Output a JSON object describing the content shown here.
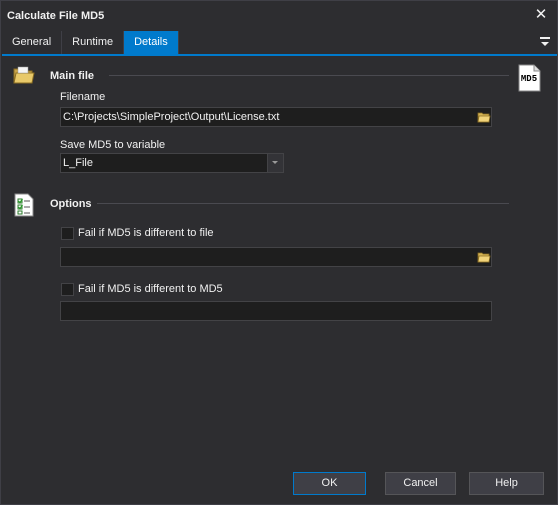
{
  "window": {
    "title": "Calculate File MD5",
    "close_glyph": "✕"
  },
  "tabs": [
    {
      "label": "General"
    },
    {
      "label": "Runtime"
    },
    {
      "label": "Details",
      "active": true
    }
  ],
  "tab_menu_icon": "tab-menu-icon",
  "main_file": {
    "section_title": "Main file",
    "icon": "folder-icon",
    "badge_icon": "md5-document-icon",
    "badge_text": "MD5",
    "filename_label": "Filename",
    "filename_value": "C:\\Projects\\SimpleProject\\Output\\License.txt",
    "variable_label": "Save MD5 to variable",
    "variable_value": "L_File"
  },
  "options": {
    "section_title": "Options",
    "icon": "checklist-icon",
    "fail_file_label": "Fail if MD5 is different to file",
    "fail_file_checked": false,
    "fail_file_value": "",
    "fail_md5_label": "Fail if MD5 is different to MD5",
    "fail_md5_checked": false,
    "fail_md5_value": ""
  },
  "buttons": {
    "ok": "OK",
    "cancel": "Cancel",
    "help": "Help"
  },
  "colors": {
    "background": "#2d2d30",
    "accent": "#007acc",
    "input_bg": "#1e1e1e",
    "text": "#f1f1f1"
  }
}
